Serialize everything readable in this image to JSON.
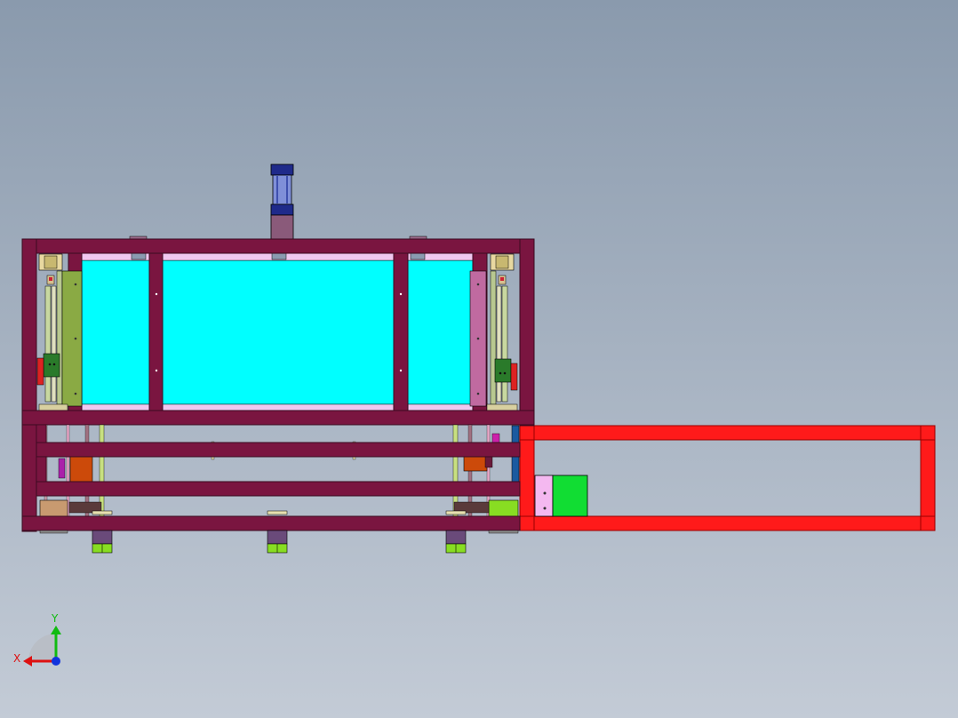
{
  "viewport": {
    "background_top": "#8a9aad",
    "background_bottom": "#c3cbd6"
  },
  "colors": {
    "frame": "#7a1540",
    "frame_edge": "#3a0a20",
    "glass": "#00ffff",
    "conveyor": "#ff1a1a",
    "conveyor_edge": "#9a0000",
    "cylinder_blue": "#1f2a8a",
    "cylinder_tube": "#7f8fd8",
    "rod_mauve": "#8a5a7a",
    "motor_green": "#11dd33",
    "motor_pink": "#f4b8f0",
    "foot_green": "#88dd22",
    "rail_olive": "#8aaa44",
    "slider_green": "#2a7a2a",
    "block_orange": "#cc4a0a",
    "block_tan": "#c89a70",
    "inner_pink": "#f0c8f0",
    "accent_blue": "#1a5aa0",
    "accent_magenta": "#cc22aa"
  },
  "triad": {
    "x_label": "X",
    "y_label": "Y",
    "x_color": "#dd1111",
    "y_color": "#11bb11",
    "z_color": "#1133dd"
  }
}
